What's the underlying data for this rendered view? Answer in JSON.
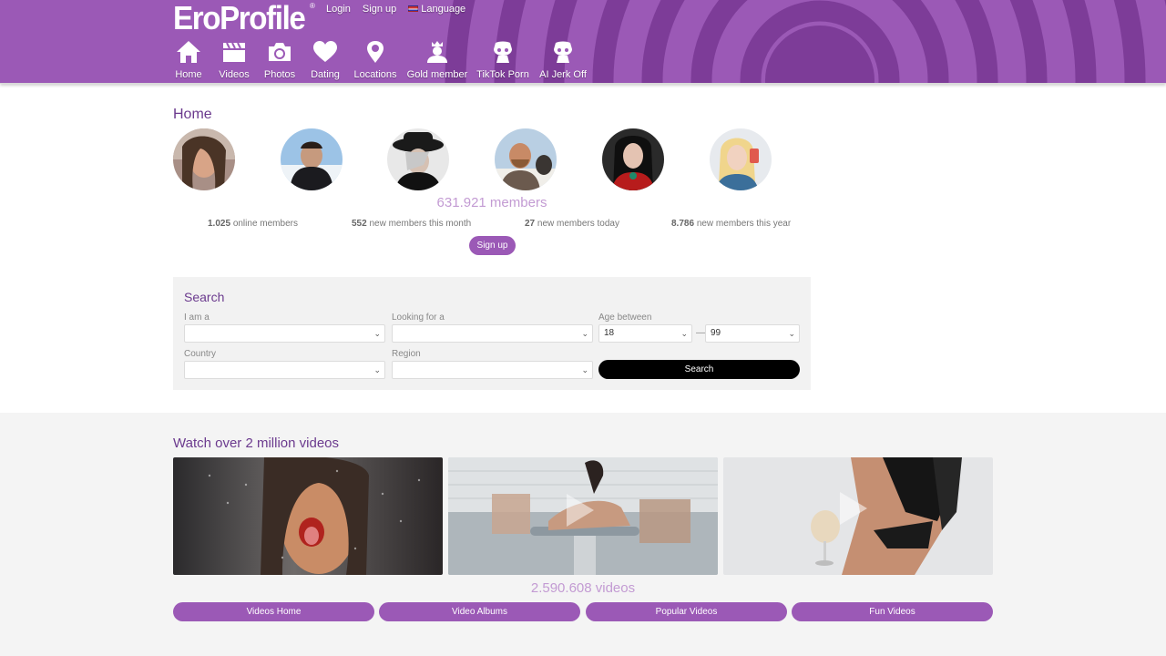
{
  "header": {
    "logo": "EroProfile",
    "logo_mark": "®",
    "top_links": [
      "Login",
      "Sign up"
    ],
    "language_label": "Language",
    "background_color": "#9b59b6",
    "nav": [
      {
        "label": "Home",
        "icon": "home-icon"
      },
      {
        "label": "Videos",
        "icon": "clapperboard-icon"
      },
      {
        "label": "Photos",
        "icon": "camera-icon"
      },
      {
        "label": "Dating",
        "icon": "heart-icon"
      },
      {
        "label": "Locations",
        "icon": "map-pin-icon"
      },
      {
        "label": "Gold member",
        "icon": "crown-user-icon"
      },
      {
        "label": "TikTok Porn",
        "icon": "bust-icon"
      },
      {
        "label": "AI Jerk Off",
        "icon": "bust-icon"
      }
    ]
  },
  "home": {
    "title": "Home",
    "members": "631.921 members",
    "stats": [
      {
        "value": "1.025",
        "label": "online members"
      },
      {
        "value": "552",
        "label": "new members this month"
      },
      {
        "value": "27",
        "label": "new members today"
      },
      {
        "value": "8.786",
        "label": "new members this year"
      }
    ],
    "signup_button": "Sign up"
  },
  "search": {
    "title": "Search",
    "i_am_label": "I am a",
    "i_am_value": "",
    "looking_for_label": "Looking for a",
    "looking_for_value": "",
    "age_label": "Age between",
    "age_min": "18",
    "age_separator": "—",
    "age_max": "99",
    "country_label": "Country",
    "country_value": "",
    "region_label": "Region",
    "region_value": "",
    "search_button": "Search"
  },
  "videos": {
    "title": "Watch over 2 million videos",
    "count": "2.590.608 videos",
    "buttons": [
      "Videos Home",
      "Video Albums",
      "Popular Videos",
      "Fun Videos"
    ]
  },
  "colors": {
    "accent": "#9b59b6",
    "heading": "#6b3a8e",
    "count_text": "#c39bd3"
  }
}
